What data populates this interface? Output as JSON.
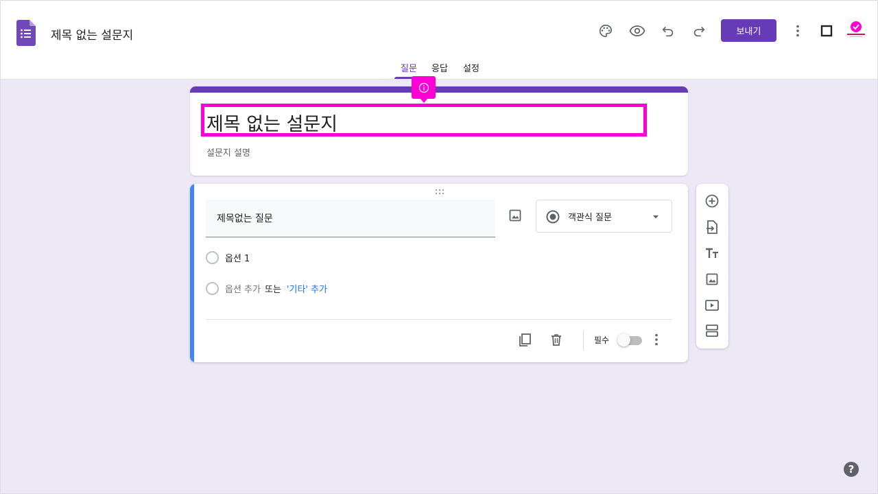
{
  "header": {
    "doc_title": "제목 없는 설문지",
    "send_label": "보내기",
    "icons": [
      "palette-icon",
      "preview-icon",
      "undo-icon",
      "redo-icon",
      "more-vert-icon",
      "square-icon",
      "avatar"
    ]
  },
  "tabs": [
    {
      "label": "질문",
      "active": true
    },
    {
      "label": "응답",
      "active": false
    },
    {
      "label": "설정",
      "active": false
    }
  ],
  "form": {
    "title": "제목 없는 설문지",
    "description": "설문지 설명"
  },
  "question": {
    "title": "제목없는 질문",
    "type_label": "객관식 질문",
    "options": [
      {
        "label": "옵션 1"
      }
    ],
    "add_option": "옵션 추가",
    "or": "또는",
    "add_other": "'기타' 추가",
    "required_label": "필수",
    "required": false
  },
  "side_tools": [
    "add-question-icon",
    "import-questions-icon",
    "add-title-icon",
    "add-image-icon",
    "add-video-icon",
    "add-section-icon"
  ],
  "help": "?",
  "colors": {
    "brand": "#673ab7",
    "highlight": "#ff00d4",
    "active_question_bar": "#4285f4",
    "background": "#ede8f6"
  }
}
